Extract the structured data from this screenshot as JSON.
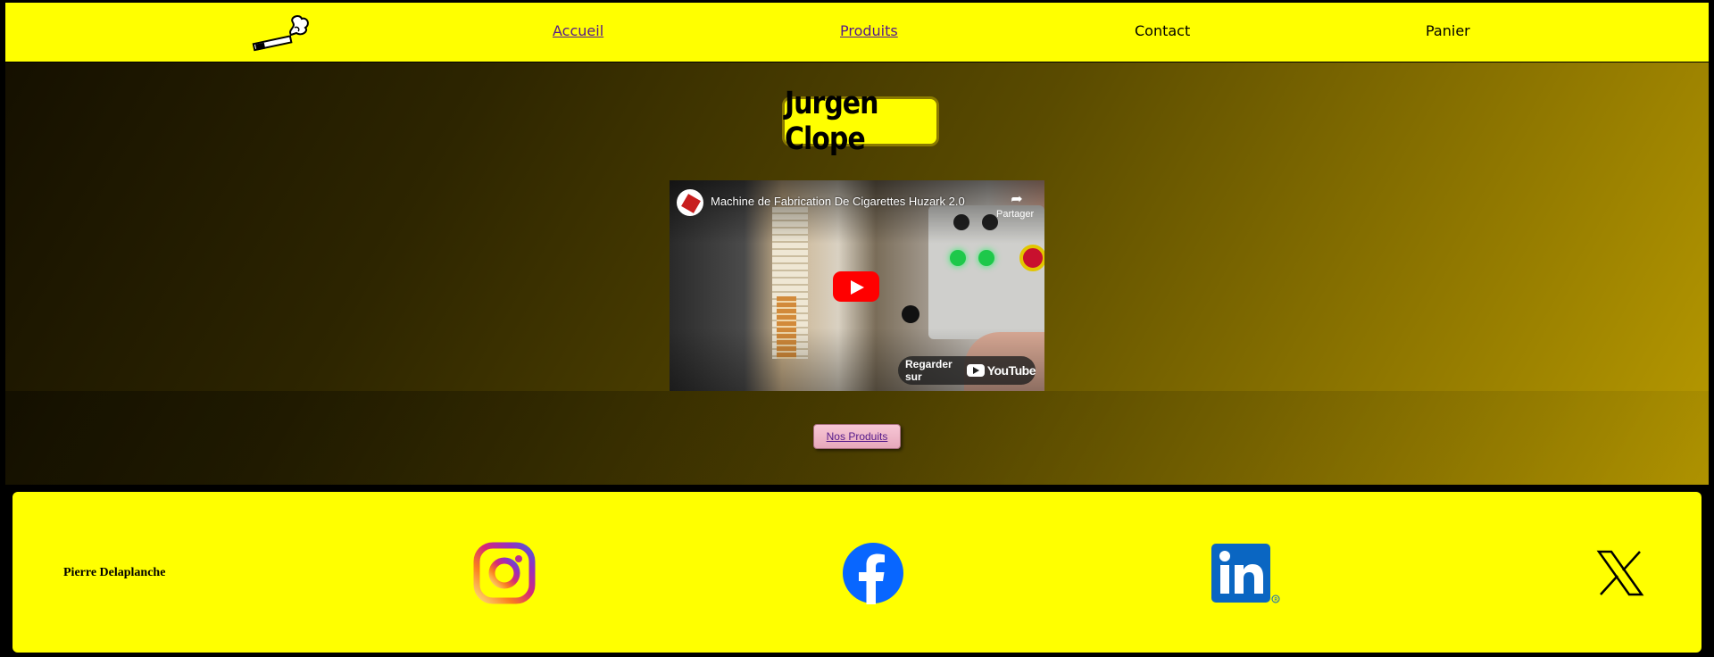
{
  "header": {
    "nav": {
      "accueil": "Accueil",
      "produits": "Produits",
      "contact": "Contact",
      "panier": "Panier"
    }
  },
  "main": {
    "brand": "Jurgen Clope",
    "video": {
      "title": "Machine de Fabrication De Cigarettes Huzark 2.0",
      "share_label": "Partager",
      "watch_label": "Regarder sur",
      "yt_brand": "YouTube"
    },
    "products_button": "Nos Produits"
  },
  "footer": {
    "author": "Pierre Delaplanche",
    "socials": [
      "instagram-icon",
      "facebook-icon",
      "linkedin-icon",
      "x-icon"
    ]
  },
  "colors": {
    "header_bg": "#ffff00",
    "footer_bg": "#ffff00",
    "youtube_red": "#ff0000",
    "visited_link": "#551a8b"
  }
}
